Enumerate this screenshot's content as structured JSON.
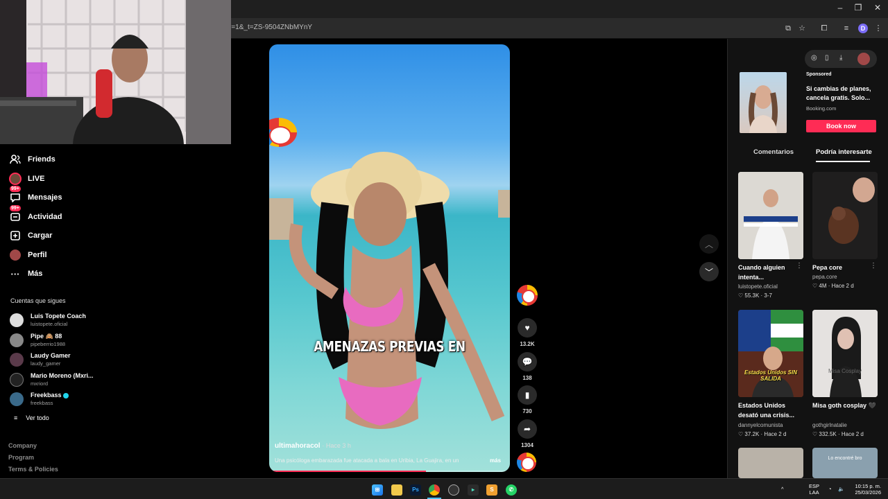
{
  "browser": {
    "url": "r=1&_t=ZS-9504ZNbMYnY",
    "profile_initial": "D"
  },
  "sidebar": {
    "items": [
      {
        "label": "Friends",
        "icon": "friends-icon"
      },
      {
        "label": "LIVE",
        "icon": "live-avatar"
      },
      {
        "label": "Mensajes",
        "icon": "messages-icon",
        "badge": "99+"
      },
      {
        "label": "Actividad",
        "icon": "activity-icon",
        "badge": "99+"
      },
      {
        "label": "Cargar",
        "icon": "upload-icon"
      },
      {
        "label": "Perfil",
        "icon": "profile-avatar"
      },
      {
        "label": "Más",
        "icon": "more-icon"
      }
    ],
    "following_title": "Cuentas que sigues",
    "following": [
      {
        "name": "Luis Topete Coach",
        "handle": "luistopete.oficial"
      },
      {
        "name": "Pipe 🙈 88",
        "handle": "pipeberrio1988"
      },
      {
        "name": "Laudy Gamer",
        "handle": "laudy_gamer"
      },
      {
        "name": "Mario Moreno (Mxri...",
        "handle": "mxriord"
      },
      {
        "name": "Freekbass",
        "handle": "freekbass"
      }
    ],
    "see_all": "Ver todo",
    "footer": [
      "Company",
      "Program",
      "Terms & Policies"
    ]
  },
  "video": {
    "caption_overlay": "AMENAZAS PREVIAS EN",
    "author": "ultimahoracol",
    "time_ago": "· Hace 3 h",
    "description": "Una psicóloga embarazada fue atacada a bala en Uribia, La Guajira, en un",
    "more": "más",
    "progress": 0.65
  },
  "actions": {
    "likes": "13.2K",
    "comments": "138",
    "saves": "730",
    "shares": "1304"
  },
  "right_panel": {
    "ad": {
      "label": "Sponsored",
      "title": "Si cambias de planes, cancela gratis. Solo...",
      "source": "Booking.com",
      "cta": "Book now"
    },
    "tabs": [
      "Comentarios",
      "Podría interesarte"
    ],
    "active_tab": "Podría interesarte",
    "cards": [
      {
        "title": "Cuando alguien intenta...",
        "author": "luistopete.oficial",
        "meta": "♡ 55.3K · 3-7"
      },
      {
        "title": "Pepa core",
        "author": "pepa.core",
        "meta": "♡ 4M · Hace 2 d"
      },
      {
        "title": "Estados Unidos desató una crisis...",
        "author": "dannyelcomunista",
        "meta": "♡ 37.2K · Hace 2 d"
      },
      {
        "title": "Misa goth cosplay 🖤",
        "author": "gothgirlnatalie",
        "meta": "♡ 332.5K · Hace 2 d"
      }
    ],
    "thumb_texts": {
      "card3": "Estados Unidos SIN SALIDA",
      "card4": "Misa Cosplay",
      "card6": "Lo encontré bro"
    }
  },
  "taskbar": {
    "lang": "ESP",
    "lang2": "LAA",
    "time": "10:15 p. m.",
    "date": "25/03/2026"
  }
}
